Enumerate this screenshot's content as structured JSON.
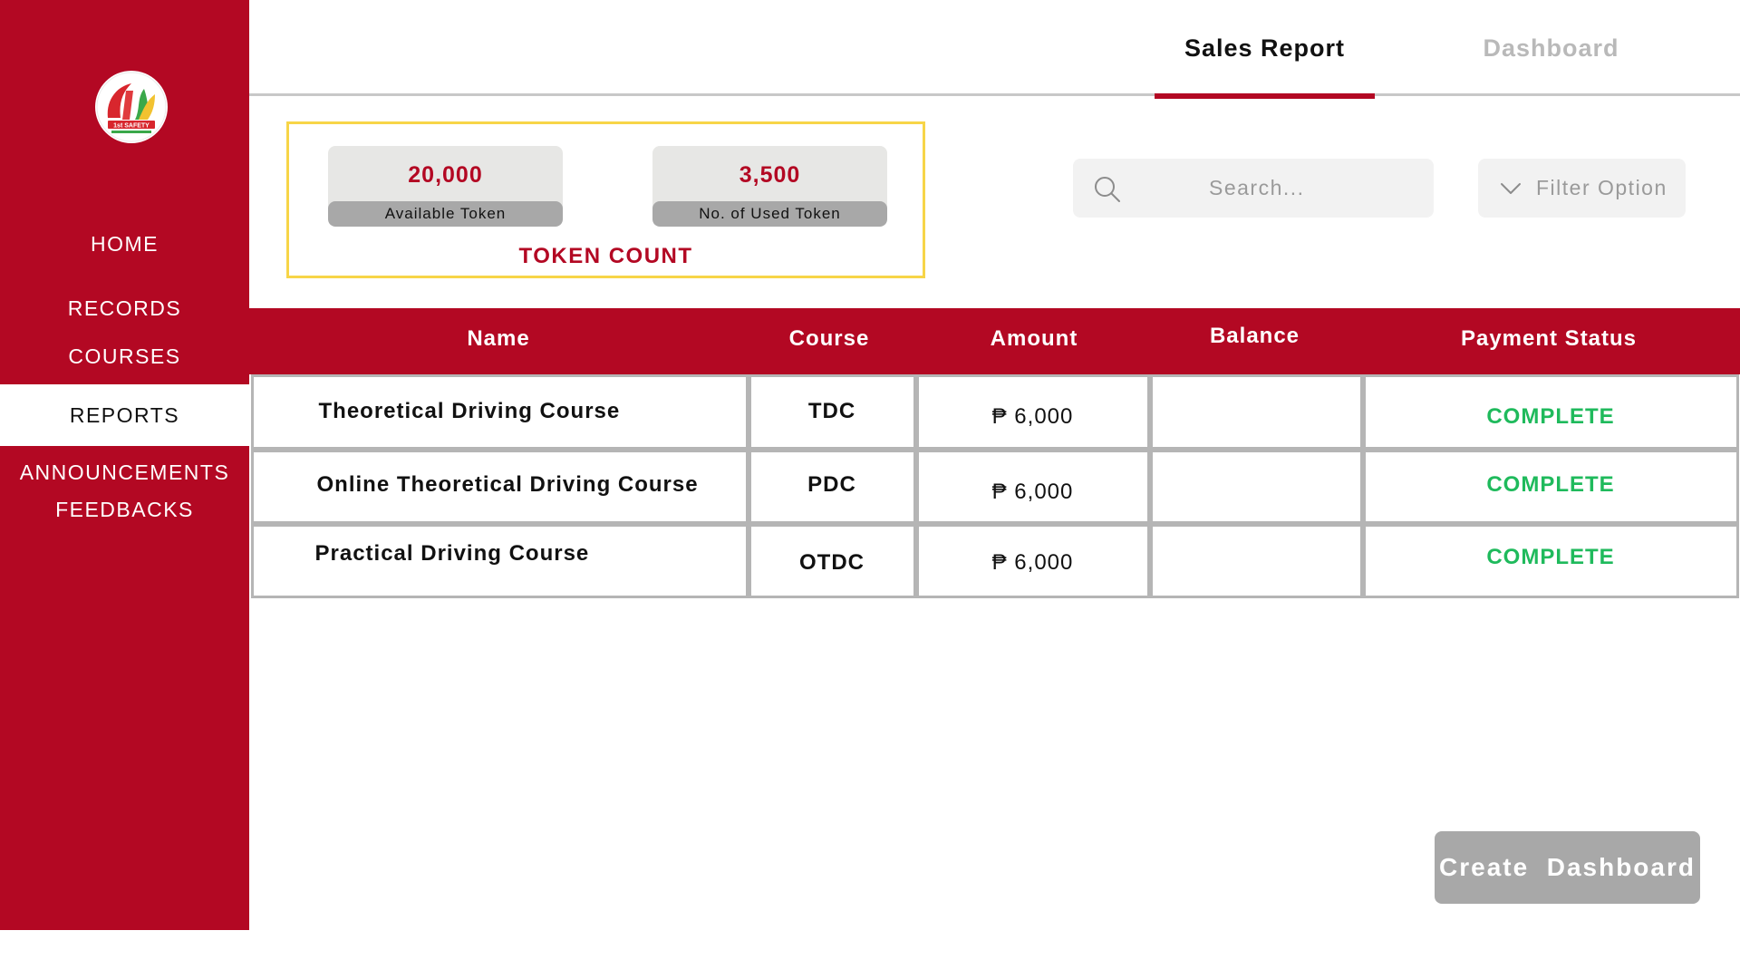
{
  "sidebar": {
    "logo_text": "1st SAFETY",
    "items": [
      {
        "label": "HOME"
      },
      {
        "label": "RECORDS"
      },
      {
        "label": "COURSES"
      },
      {
        "label": "REPORTS",
        "active": true
      },
      {
        "label": "ANNOUNCEMENTS"
      },
      {
        "label": "FEEDBACKS"
      }
    ]
  },
  "tabs": [
    {
      "label": "Sales Report",
      "active": true
    },
    {
      "label": "Dashboard",
      "active": false
    }
  ],
  "token_count": {
    "title": "TOKEN COUNT",
    "available": {
      "value": "20,000",
      "label": "Available Token"
    },
    "used": {
      "value": "3,500",
      "label": "No. of Used Token"
    }
  },
  "search": {
    "placeholder": "Search..."
  },
  "filter": {
    "label": "Filter Option"
  },
  "table": {
    "columns": [
      "Name",
      "Course",
      "Amount",
      "Balance",
      "Payment Status"
    ],
    "rows": [
      {
        "name": "Theoretical Driving Course",
        "course": "TDC",
        "amount": "₱ 6,000",
        "balance": "",
        "status": "COMPLETE"
      },
      {
        "name": "Online Theoretical Driving Course",
        "course": "PDC",
        "amount": "₱ 6,000",
        "balance": "",
        "status": "COMPLETE"
      },
      {
        "name": "Practical Driving Course",
        "course": "OTDC",
        "amount": "₱ 6,000",
        "balance": "",
        "status": "COMPLETE"
      }
    ]
  },
  "create_button": {
    "label": "Create  Dashboard"
  },
  "colors": {
    "brand_red": "#b30823",
    "token_border": "#f7d548",
    "status_green": "#1fba5c",
    "muted_gray": "#a8a8a8"
  }
}
